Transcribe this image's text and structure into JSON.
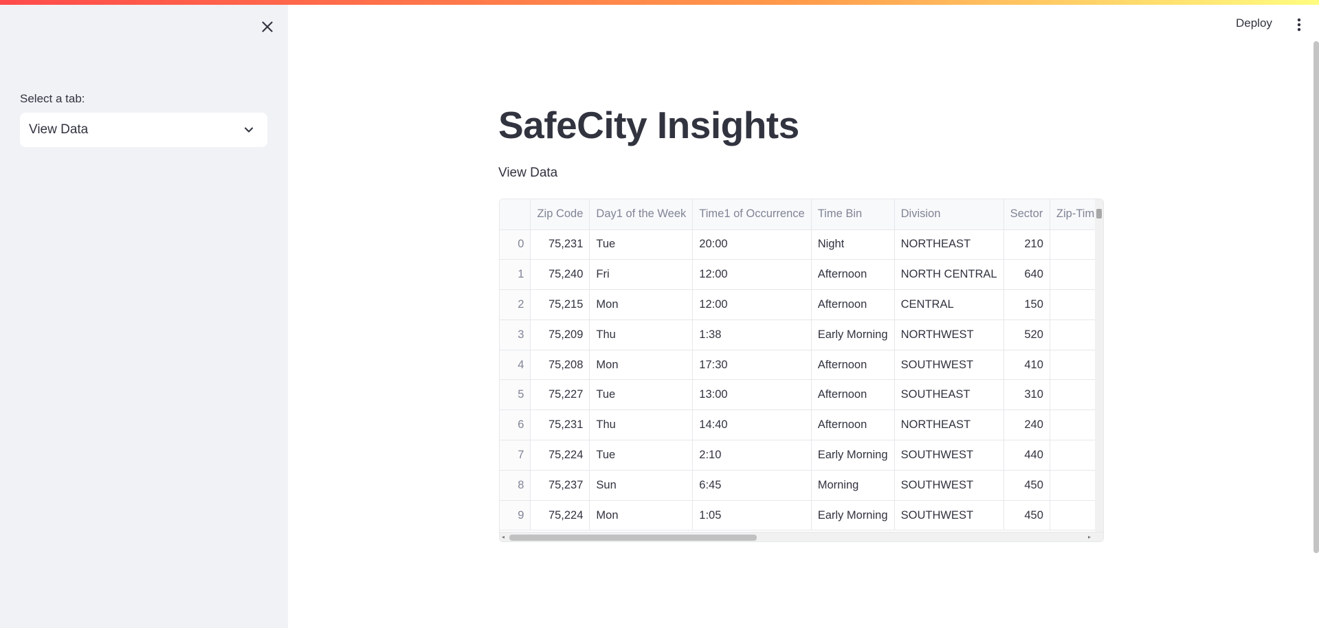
{
  "sidebar": {
    "select_label": "Select a tab:",
    "select_value": "View Data"
  },
  "header": {
    "deploy_label": "Deploy"
  },
  "main": {
    "title": "SafeCity Insights",
    "subtitle": "View Data"
  },
  "table": {
    "columns": [
      "",
      "Zip Code",
      "Day1 of the Week",
      "Time1 of Occurrence",
      "Time Bin",
      "Division",
      "Sector",
      "Zip-Tim"
    ],
    "rows": [
      [
        "0",
        "75,231",
        "Tue",
        "20:00",
        "Night",
        "NORTHEAST",
        "210",
        ""
      ],
      [
        "1",
        "75,240",
        "Fri",
        "12:00",
        "Afternoon",
        "NORTH CENTRAL",
        "640",
        ""
      ],
      [
        "2",
        "75,215",
        "Mon",
        "12:00",
        "Afternoon",
        "CENTRAL",
        "150",
        ""
      ],
      [
        "3",
        "75,209",
        "Thu",
        "1:38",
        "Early Morning",
        "NORTHWEST",
        "520",
        ""
      ],
      [
        "4",
        "75,208",
        "Mon",
        "17:30",
        "Afternoon",
        "SOUTHWEST",
        "410",
        ""
      ],
      [
        "5",
        "75,227",
        "Tue",
        "13:00",
        "Afternoon",
        "SOUTHEAST",
        "310",
        ""
      ],
      [
        "6",
        "75,231",
        "Thu",
        "14:40",
        "Afternoon",
        "NORTHEAST",
        "240",
        ""
      ],
      [
        "7",
        "75,224",
        "Tue",
        "2:10",
        "Early Morning",
        "SOUTHWEST",
        "440",
        ""
      ],
      [
        "8",
        "75,237",
        "Sun",
        "6:45",
        "Morning",
        "SOUTHWEST",
        "450",
        ""
      ],
      [
        "9",
        "75,224",
        "Mon",
        "1:05",
        "Early Morning",
        "SOUTHWEST",
        "450",
        ""
      ]
    ]
  },
  "colors": {
    "sidebar_bg": "#f0f2f6",
    "text": "#31333f",
    "muted": "#808495",
    "accent_start": "#ff4b4b",
    "accent_end": "#fffd80"
  }
}
